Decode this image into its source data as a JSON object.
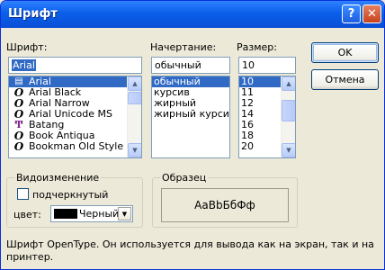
{
  "window": {
    "title": "Шрифт"
  },
  "titlebar": {
    "help_label": "?",
    "close_label": "✕"
  },
  "font": {
    "label": "Шрифт:",
    "value": "Arial",
    "items": [
      {
        "name": "Arial",
        "icon": "printer-icon"
      },
      {
        "name": "Arial Black",
        "icon": "opentype-icon"
      },
      {
        "name": "Arial Narrow",
        "icon": "opentype-icon"
      },
      {
        "name": "Arial Unicode MS",
        "icon": "opentype-icon"
      },
      {
        "name": "Batang",
        "icon": "truetype-icon"
      },
      {
        "name": "Book Antiqua",
        "icon": "opentype-icon"
      },
      {
        "name": "Bookman Old Style",
        "icon": "opentype-icon"
      }
    ],
    "selected_index": 0
  },
  "style": {
    "label": "Начертание:",
    "value": "обычный",
    "items": [
      "обычный",
      "курсив",
      "жирный",
      "жирный курсив"
    ],
    "selected_index": 0
  },
  "size": {
    "label": "Размер:",
    "value": "10",
    "items": [
      "10",
      "11",
      "12",
      "14",
      "16",
      "18",
      "20"
    ],
    "selected_index": 0
  },
  "buttons": {
    "ok": "OK",
    "cancel": "Отмена"
  },
  "effects": {
    "title": "Видоизменение",
    "underline_label": "подчеркнутый",
    "underline_checked": false,
    "color_label": "цвет:",
    "color_value": "Черный",
    "color_swatch": "#000000"
  },
  "sample": {
    "title": "Образец",
    "text": "AaBbБбФф"
  },
  "description": "Шрифт OpenType. Он используется для вывода как на экран, так и на принтер.",
  "colors": {
    "titlebar": "#0A5FEA",
    "selection": "#316AC5",
    "face": "#ECE9D8"
  }
}
